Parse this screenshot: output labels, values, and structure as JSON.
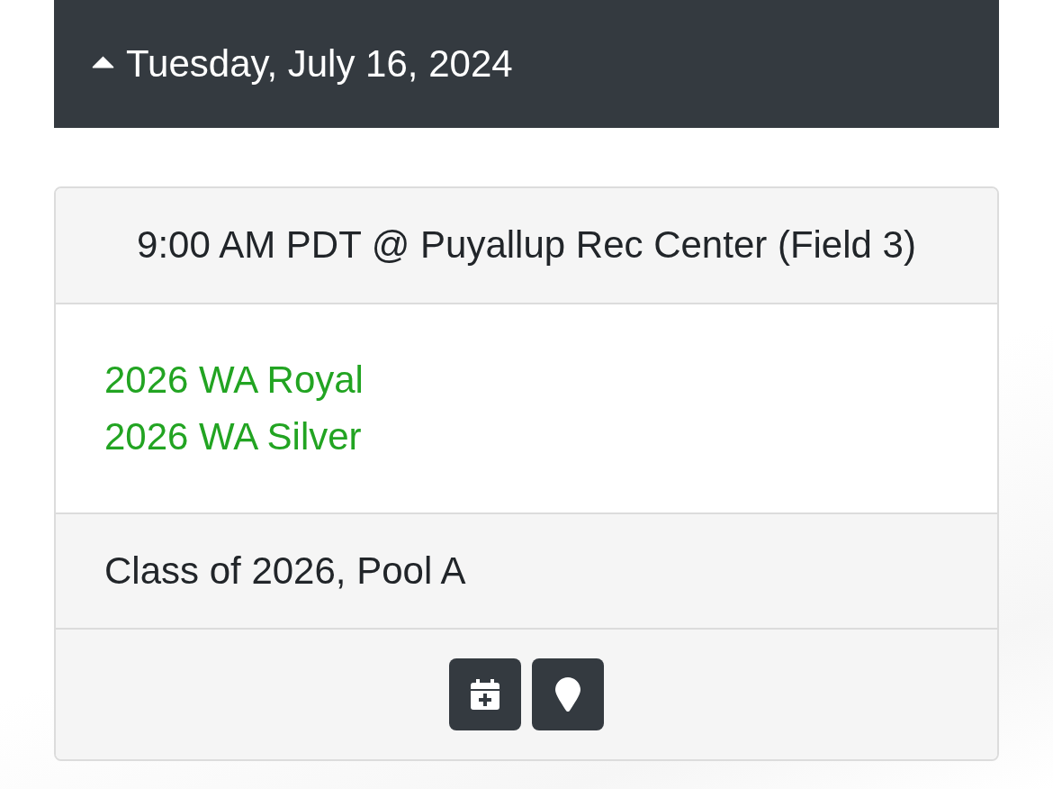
{
  "date_header": {
    "title": "Tuesday, July 16, 2024",
    "expanded": true
  },
  "games": [
    {
      "time_location": "9:00 AM PDT @ Puyallup Rec Center (Field 3)",
      "teams": [
        "2026 WA Royal",
        "2026 WA Silver"
      ],
      "division": "Class of 2026, Pool A",
      "actions": [
        {
          "kind": "calendar"
        },
        {
          "kind": "map"
        }
      ]
    }
  ]
}
